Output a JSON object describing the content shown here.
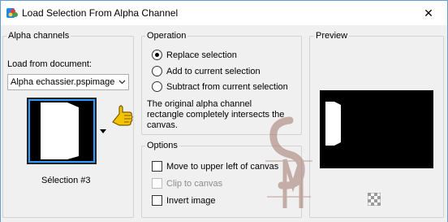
{
  "window": {
    "title": "Load Selection From Alpha Channel",
    "close_glyph": "✕"
  },
  "alpha_channels": {
    "legend": "Alpha channels",
    "load_from_label": "Load from document:",
    "document_value": "Alpha echassier.pspimage",
    "selection_name": "Sélection #3"
  },
  "operation": {
    "legend": "Operation",
    "options": [
      {
        "label": "Replace selection",
        "selected": true
      },
      {
        "label": "Add to current selection",
        "selected": false
      },
      {
        "label": "Subtract from current selection",
        "selected": false
      }
    ],
    "info_text_1": "The original alpha channel",
    "info_text_2": "rectangle completely intersects the",
    "info_text_3": "canvas."
  },
  "options": {
    "legend": "Options",
    "move_upper_left": "Move to upper left of canvas",
    "clip_to_canvas": "Clip to canvas",
    "invert_image": "Invert image"
  },
  "preview": {
    "legend": "Preview"
  },
  "watermark": {
    "letters": "SM"
  },
  "colors": {
    "accent": "#3399ff",
    "pointer": "#f5c400"
  }
}
